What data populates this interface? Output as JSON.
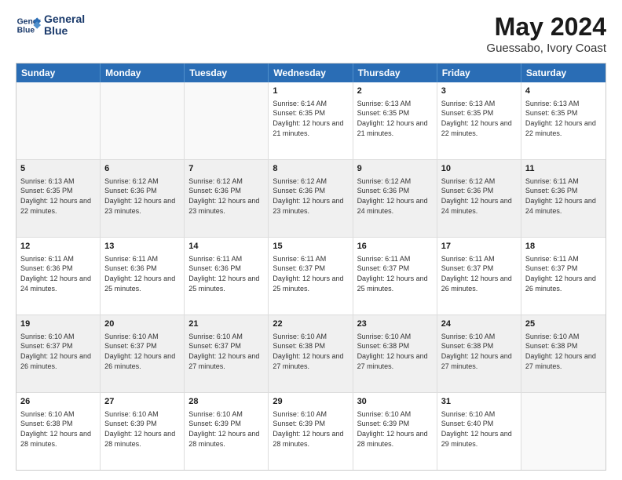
{
  "header": {
    "logo_line1": "General",
    "logo_line2": "Blue",
    "month_title": "May 2024",
    "location": "Guessabo, Ivory Coast"
  },
  "days_of_week": [
    "Sunday",
    "Monday",
    "Tuesday",
    "Wednesday",
    "Thursday",
    "Friday",
    "Saturday"
  ],
  "rows": [
    [
      {
        "day": "",
        "sunrise": "",
        "sunset": "",
        "daylight": "",
        "empty": true
      },
      {
        "day": "",
        "sunrise": "",
        "sunset": "",
        "daylight": "",
        "empty": true
      },
      {
        "day": "",
        "sunrise": "",
        "sunset": "",
        "daylight": "",
        "empty": true
      },
      {
        "day": "1",
        "sunrise": "Sunrise: 6:14 AM",
        "sunset": "Sunset: 6:35 PM",
        "daylight": "Daylight: 12 hours and 21 minutes."
      },
      {
        "day": "2",
        "sunrise": "Sunrise: 6:13 AM",
        "sunset": "Sunset: 6:35 PM",
        "daylight": "Daylight: 12 hours and 21 minutes."
      },
      {
        "day": "3",
        "sunrise": "Sunrise: 6:13 AM",
        "sunset": "Sunset: 6:35 PM",
        "daylight": "Daylight: 12 hours and 22 minutes."
      },
      {
        "day": "4",
        "sunrise": "Sunrise: 6:13 AM",
        "sunset": "Sunset: 6:35 PM",
        "daylight": "Daylight: 12 hours and 22 minutes."
      }
    ],
    [
      {
        "day": "5",
        "sunrise": "Sunrise: 6:13 AM",
        "sunset": "Sunset: 6:35 PM",
        "daylight": "Daylight: 12 hours and 22 minutes."
      },
      {
        "day": "6",
        "sunrise": "Sunrise: 6:12 AM",
        "sunset": "Sunset: 6:36 PM",
        "daylight": "Daylight: 12 hours and 23 minutes."
      },
      {
        "day": "7",
        "sunrise": "Sunrise: 6:12 AM",
        "sunset": "Sunset: 6:36 PM",
        "daylight": "Daylight: 12 hours and 23 minutes."
      },
      {
        "day": "8",
        "sunrise": "Sunrise: 6:12 AM",
        "sunset": "Sunset: 6:36 PM",
        "daylight": "Daylight: 12 hours and 23 minutes."
      },
      {
        "day": "9",
        "sunrise": "Sunrise: 6:12 AM",
        "sunset": "Sunset: 6:36 PM",
        "daylight": "Daylight: 12 hours and 24 minutes."
      },
      {
        "day": "10",
        "sunrise": "Sunrise: 6:12 AM",
        "sunset": "Sunset: 6:36 PM",
        "daylight": "Daylight: 12 hours and 24 minutes."
      },
      {
        "day": "11",
        "sunrise": "Sunrise: 6:11 AM",
        "sunset": "Sunset: 6:36 PM",
        "daylight": "Daylight: 12 hours and 24 minutes."
      }
    ],
    [
      {
        "day": "12",
        "sunrise": "Sunrise: 6:11 AM",
        "sunset": "Sunset: 6:36 PM",
        "daylight": "Daylight: 12 hours and 24 minutes."
      },
      {
        "day": "13",
        "sunrise": "Sunrise: 6:11 AM",
        "sunset": "Sunset: 6:36 PM",
        "daylight": "Daylight: 12 hours and 25 minutes."
      },
      {
        "day": "14",
        "sunrise": "Sunrise: 6:11 AM",
        "sunset": "Sunset: 6:36 PM",
        "daylight": "Daylight: 12 hours and 25 minutes."
      },
      {
        "day": "15",
        "sunrise": "Sunrise: 6:11 AM",
        "sunset": "Sunset: 6:37 PM",
        "daylight": "Daylight: 12 hours and 25 minutes."
      },
      {
        "day": "16",
        "sunrise": "Sunrise: 6:11 AM",
        "sunset": "Sunset: 6:37 PM",
        "daylight": "Daylight: 12 hours and 25 minutes."
      },
      {
        "day": "17",
        "sunrise": "Sunrise: 6:11 AM",
        "sunset": "Sunset: 6:37 PM",
        "daylight": "Daylight: 12 hours and 26 minutes."
      },
      {
        "day": "18",
        "sunrise": "Sunrise: 6:11 AM",
        "sunset": "Sunset: 6:37 PM",
        "daylight": "Daylight: 12 hours and 26 minutes."
      }
    ],
    [
      {
        "day": "19",
        "sunrise": "Sunrise: 6:10 AM",
        "sunset": "Sunset: 6:37 PM",
        "daylight": "Daylight: 12 hours and 26 minutes."
      },
      {
        "day": "20",
        "sunrise": "Sunrise: 6:10 AM",
        "sunset": "Sunset: 6:37 PM",
        "daylight": "Daylight: 12 hours and 26 minutes."
      },
      {
        "day": "21",
        "sunrise": "Sunrise: 6:10 AM",
        "sunset": "Sunset: 6:37 PM",
        "daylight": "Daylight: 12 hours and 27 minutes."
      },
      {
        "day": "22",
        "sunrise": "Sunrise: 6:10 AM",
        "sunset": "Sunset: 6:38 PM",
        "daylight": "Daylight: 12 hours and 27 minutes."
      },
      {
        "day": "23",
        "sunrise": "Sunrise: 6:10 AM",
        "sunset": "Sunset: 6:38 PM",
        "daylight": "Daylight: 12 hours and 27 minutes."
      },
      {
        "day": "24",
        "sunrise": "Sunrise: 6:10 AM",
        "sunset": "Sunset: 6:38 PM",
        "daylight": "Daylight: 12 hours and 27 minutes."
      },
      {
        "day": "25",
        "sunrise": "Sunrise: 6:10 AM",
        "sunset": "Sunset: 6:38 PM",
        "daylight": "Daylight: 12 hours and 27 minutes."
      }
    ],
    [
      {
        "day": "26",
        "sunrise": "Sunrise: 6:10 AM",
        "sunset": "Sunset: 6:38 PM",
        "daylight": "Daylight: 12 hours and 28 minutes."
      },
      {
        "day": "27",
        "sunrise": "Sunrise: 6:10 AM",
        "sunset": "Sunset: 6:39 PM",
        "daylight": "Daylight: 12 hours and 28 minutes."
      },
      {
        "day": "28",
        "sunrise": "Sunrise: 6:10 AM",
        "sunset": "Sunset: 6:39 PM",
        "daylight": "Daylight: 12 hours and 28 minutes."
      },
      {
        "day": "29",
        "sunrise": "Sunrise: 6:10 AM",
        "sunset": "Sunset: 6:39 PM",
        "daylight": "Daylight: 12 hours and 28 minutes."
      },
      {
        "day": "30",
        "sunrise": "Sunrise: 6:10 AM",
        "sunset": "Sunset: 6:39 PM",
        "daylight": "Daylight: 12 hours and 28 minutes."
      },
      {
        "day": "31",
        "sunrise": "Sunrise: 6:10 AM",
        "sunset": "Sunset: 6:40 PM",
        "daylight": "Daylight: 12 hours and 29 minutes."
      },
      {
        "day": "",
        "sunrise": "",
        "sunset": "",
        "daylight": "",
        "empty": true
      }
    ]
  ]
}
